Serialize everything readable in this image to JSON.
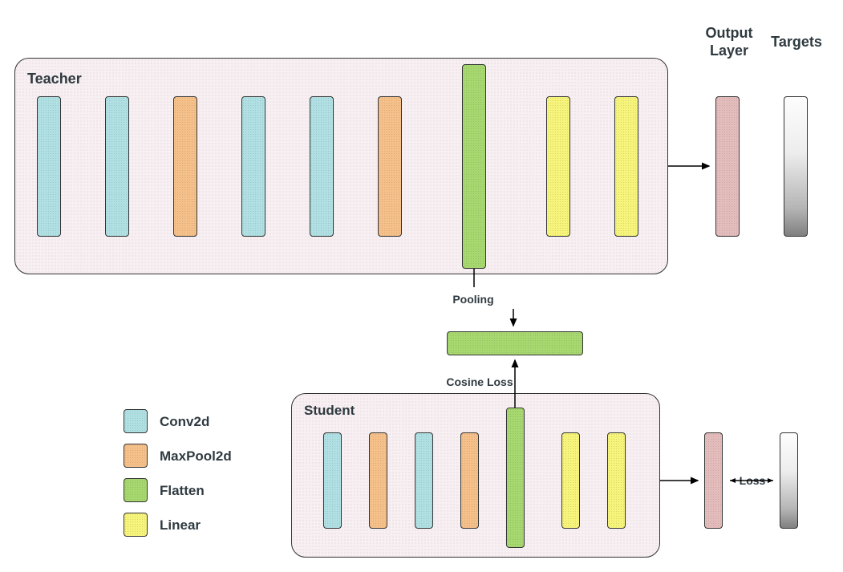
{
  "labels": {
    "teacher": "Teacher",
    "student": "Student",
    "output_layer_l1": "Output",
    "output_layer_l2": "Layer",
    "targets": "Targets",
    "pooling": "Pooling",
    "cosine_loss": "Cosine Loss",
    "loss": "Loss"
  },
  "legend": {
    "conv2d": "Conv2d",
    "maxpool2d": "MaxPool2d",
    "flatten": "Flatten",
    "linear": "Linear"
  },
  "teacher_layers": [
    {
      "type": "conv",
      "name": "teacher-conv-1"
    },
    {
      "type": "conv",
      "name": "teacher-conv-2"
    },
    {
      "type": "pool",
      "name": "teacher-pool-1"
    },
    {
      "type": "conv",
      "name": "teacher-conv-3"
    },
    {
      "type": "conv",
      "name": "teacher-conv-4"
    },
    {
      "type": "pool",
      "name": "teacher-pool-2"
    },
    {
      "type": "flat",
      "name": "teacher-flatten"
    },
    {
      "type": "linear",
      "name": "teacher-linear-1"
    },
    {
      "type": "linear",
      "name": "teacher-linear-2"
    }
  ],
  "student_layers": [
    {
      "type": "conv",
      "name": "student-conv-1"
    },
    {
      "type": "pool",
      "name": "student-pool-1"
    },
    {
      "type": "conv",
      "name": "student-conv-2"
    },
    {
      "type": "pool",
      "name": "student-pool-2"
    },
    {
      "type": "flat",
      "name": "student-flatten"
    },
    {
      "type": "linear",
      "name": "student-linear-1"
    },
    {
      "type": "linear",
      "name": "student-linear-2"
    }
  ],
  "colors": {
    "conv": "#b0e0e3",
    "pool": "#f5c08a",
    "flat": "#a7d86f",
    "linear": "#f6f47a",
    "output": "#e4bcbc"
  }
}
